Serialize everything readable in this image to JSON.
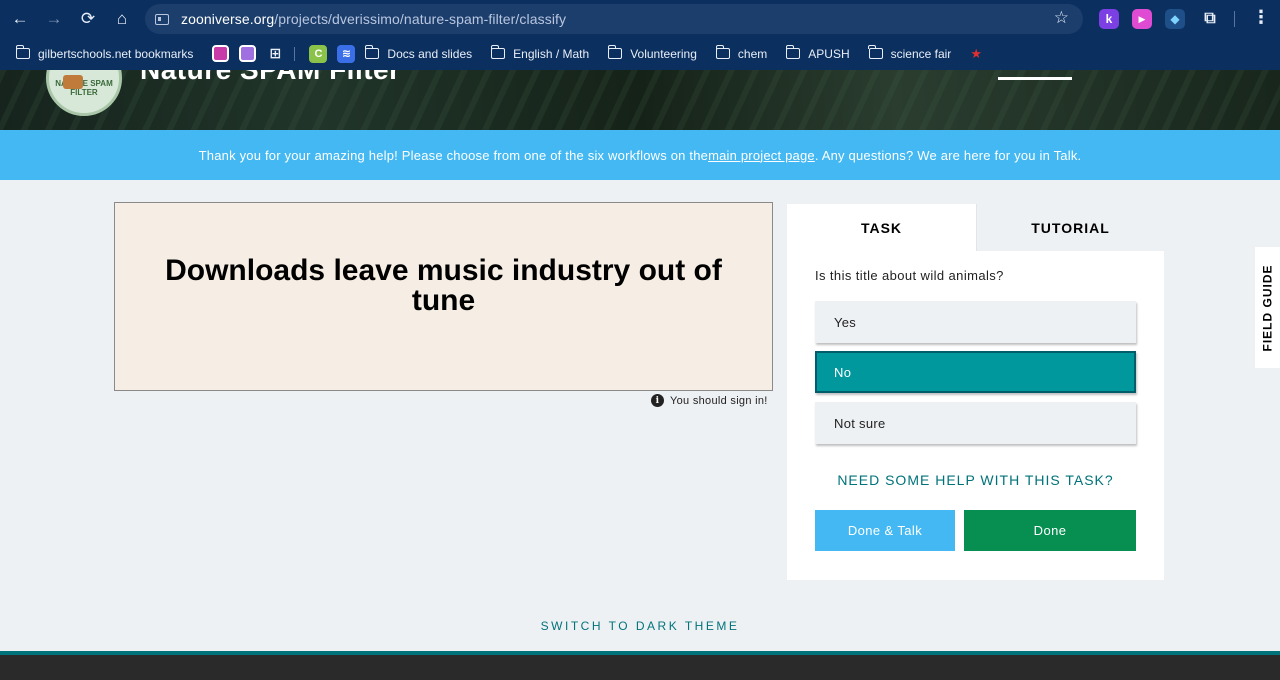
{
  "browser": {
    "url_host": "zooniverse.org",
    "url_path": "/projects/dverissimo/nature-spam-filter/classify",
    "extensions": [
      {
        "name": "k-extension-icon",
        "glyph": "k",
        "color": "#7b3fe4"
      },
      {
        "name": "video-extension-icon",
        "glyph": "▶",
        "color": "#e04bd4"
      },
      {
        "name": "puzzle-color-extension-icon",
        "glyph": "◆",
        "color": "#3a7bd5"
      }
    ],
    "bookmarks": {
      "first": "gilbertschools.net bookmarks",
      "folders": [
        "Docs and slides",
        "English / Math",
        "Volunteering",
        "chem",
        "APUSH",
        "science fair"
      ]
    }
  },
  "hero": {
    "title": "Nature SPAM Filter",
    "logo_text": "NATURE SPAM FILTER"
  },
  "announcement": {
    "before": "Thank you for your amazing help! Please choose from one of the six workflows on the ",
    "link": "main project page",
    "after": ". Any questions? We are here for you in Talk."
  },
  "subject": {
    "text": "Downloads leave music industry out of tune",
    "signin_note": "You should sign in!"
  },
  "task": {
    "tabs": [
      "TASK",
      "TUTORIAL"
    ],
    "question": "Is this title about wild animals?",
    "answers": [
      "Yes",
      "No",
      "Not sure"
    ],
    "selected_answer": "No",
    "help_link": "NEED SOME HELP WITH THIS TASK?",
    "done_talk_label": "Done & Talk",
    "done_label": "Done"
  },
  "field_guide": "FIELD GUIDE",
  "dark_theme_label": "SWITCH TO DARK THEME"
}
